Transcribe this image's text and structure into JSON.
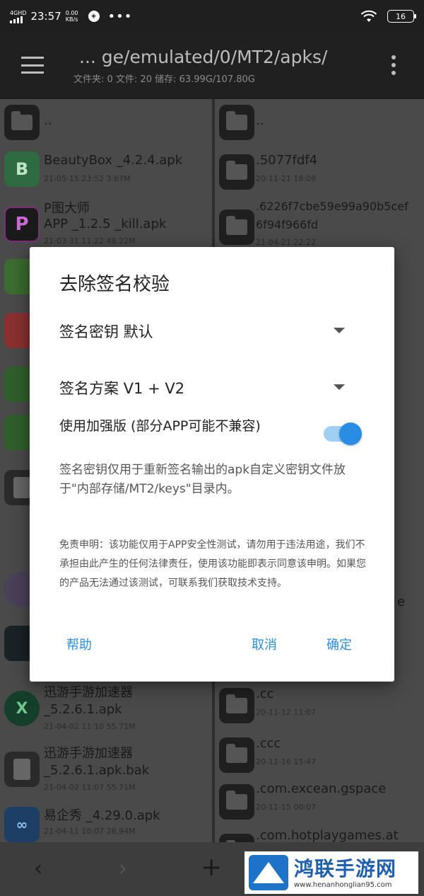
{
  "status_bar": {
    "network": "4GHD",
    "time": "23:57",
    "speed_value": "0.00",
    "speed_unit": "KB/s",
    "more": "•••",
    "battery": "16"
  },
  "app_bar": {
    "path": "... ge/emulated/0/MT2/apks/",
    "info": "文件夹: 0  文件: 20  储存: 63.99G/107.80G"
  },
  "left_pane": {
    "up_label": "..",
    "items": [
      {
        "name": "BeautyBox _4.2.4.apk",
        "meta": "21-05-15 23:52  3.67M",
        "icon": "beautybox-icon",
        "letter": "B"
      },
      {
        "name": "P图大师",
        "name2": "APP _1.2.5 _kill.apk",
        "meta": "21-03-31 11:22  48.22M",
        "icon": "p-master-icon",
        "letter": "P"
      },
      {
        "name": "迅游手游加速器",
        "name2": "_5.2.6.1.apk",
        "meta": "21-04-02 11:10  55.71M",
        "icon": "xunyou-icon",
        "letter": "X"
      },
      {
        "name": "迅游手游加速器",
        "name2": "_5.2.6.1.apk.bak",
        "meta": "21-04-02 11:07  55.71M",
        "icon": "document-icon"
      },
      {
        "name": "易企秀 _4.29.0.apk",
        "meta": "21-04-11 10:07  28.94M",
        "icon": "eqxiu-icon",
        "letter": "∞"
      }
    ]
  },
  "right_pane": {
    "up_label": "..",
    "items": [
      {
        "name": ".5077fdf4",
        "meta": "20-11-21 18:09"
      },
      {
        "name": ".6226f7cbe59e99a90b5cef",
        "name2": "6f94f966fd",
        "meta": "21-04-21 22:22"
      },
      {
        "name": ".cc",
        "meta": "20-11-12 11:07"
      },
      {
        "name": ".ccc",
        "meta": "20-11-16 15:47"
      },
      {
        "name": ".com.excean.gspace",
        "meta": "20-11-15 00:07"
      },
      {
        "name": ".com.hotplaygames.at",
        "meta": ""
      }
    ],
    "partial_text": "e"
  },
  "dialog": {
    "title": "去除签名校验",
    "key_select": "签名密钥  默认",
    "scheme_select": "签名方案  V1 + V2",
    "enhanced_label": "使用加强版 (部分APP可能不兼容)",
    "enhanced_on": true,
    "note": "签名密钥仅用于重新签名输出的apk自定义密钥文件放于\"内部存储/MT2/keys\"目录内。",
    "disclaimer": "免责申明：该功能仅用于APP安全性测试，请勿用于违法用途，我们不承担由此产生的任何法律责任，使用该功能即表示同意该申明。如果您的产品无法通过该测试，可联系我们获取技术支持。",
    "help_button": "帮助",
    "cancel_button": "取消",
    "ok_button": "确定"
  },
  "bottom_bar": {
    "back": "‹",
    "forward": "›",
    "add": "+"
  },
  "watermark": {
    "title": "鸿联手游网",
    "url": "www.henanhonglian95.com"
  },
  "colors": {
    "accent": "#2a8de4",
    "switch_track": "#9fd0f3"
  }
}
